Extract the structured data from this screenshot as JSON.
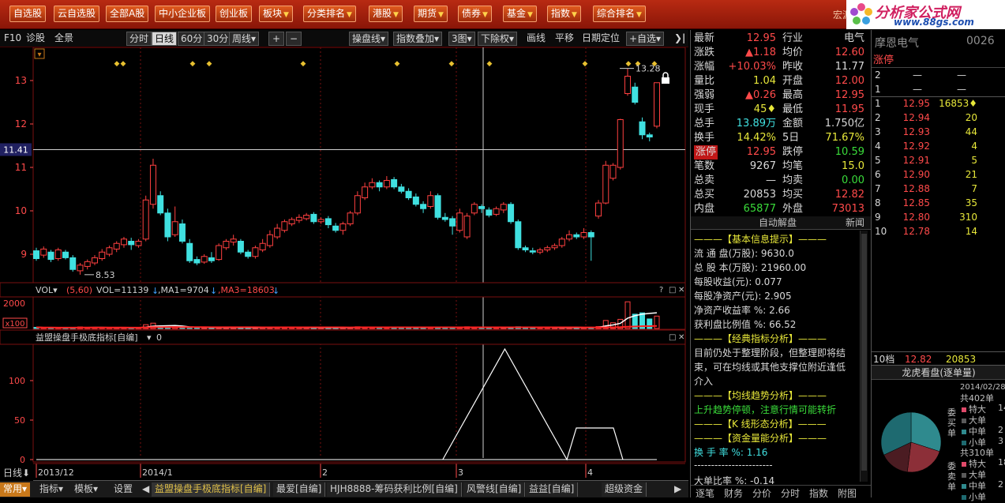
{
  "top_nav": {
    "items": [
      {
        "label": "自选股",
        "dropdown": false
      },
      {
        "label": "云自选股",
        "dropdown": false
      },
      {
        "label": "全部A股",
        "dropdown": false
      },
      {
        "label": "中小企业板",
        "dropdown": false
      },
      {
        "label": "创业板",
        "dropdown": false
      },
      {
        "label": "板块",
        "dropdown": true
      },
      {
        "label": "分类排名",
        "dropdown": true
      },
      {
        "label": "港股",
        "dropdown": true
      },
      {
        "label": "期货",
        "dropdown": true
      },
      {
        "label": "债券",
        "dropdown": true
      },
      {
        "label": "基金",
        "dropdown": true
      },
      {
        "label": "指数",
        "dropdown": true
      },
      {
        "label": "综合排名",
        "dropdown": true
      }
    ],
    "logo_title": "分析家公式网",
    "logo_url": "www.88gs.com",
    "logo_behind": "宏源大",
    "accent": "#b82a12"
  },
  "toolbar": {
    "f10": "F10",
    "diagnose": "诊股",
    "panorama": "全景",
    "periods": [
      "分时",
      "日线",
      "60分",
      "30分"
    ],
    "week": "周线▾",
    "zoom_in": "+",
    "zoom_out": "−",
    "manipulate": "操盘线▾",
    "index_overlay": "指数叠加▾",
    "three_chart": "3图▾",
    "exright": "下除权▾",
    "draw": "画线",
    "pan": "平移",
    "date_locate": "日期定位",
    "add_watch": "+自选▾"
  },
  "chart_data": {
    "type": "candlestick",
    "price_axis": {
      "ticks": [
        9,
        10,
        11,
        12,
        13
      ],
      "range": [
        8.3,
        13.5
      ]
    },
    "crosshair_price": "11.41",
    "high_label": "13.28",
    "low_label": "8.53",
    "x_labels": [
      "2013/12",
      "2014/1",
      "2",
      "3",
      "4"
    ],
    "candles": [
      [
        9.08,
        8.9,
        9.15,
        8.85
      ],
      [
        8.98,
        9.12,
        9.18,
        8.92
      ],
      [
        9.05,
        8.88,
        9.1,
        8.82
      ],
      [
        8.9,
        9.1,
        9.15,
        8.85
      ],
      [
        9.05,
        8.92,
        9.1,
        8.88
      ],
      [
        8.92,
        8.65,
        8.98,
        8.6
      ],
      [
        8.62,
        8.75,
        8.8,
        8.53
      ],
      [
        8.72,
        8.83,
        8.88,
        8.65
      ],
      [
        8.8,
        8.92,
        8.98,
        8.75
      ],
      [
        8.9,
        9.05,
        9.12,
        8.85
      ],
      [
        9.0,
        9.15,
        9.2,
        8.95
      ],
      [
        9.12,
        9.25,
        9.3,
        9.05
      ],
      [
        9.22,
        9.35,
        9.4,
        9.15
      ],
      [
        9.3,
        9.22,
        9.38,
        9.1
      ],
      [
        9.2,
        9.3,
        9.35,
        9.15
      ],
      [
        9.35,
        10.25,
        10.35,
        9.3
      ],
      [
        10.15,
        11.05,
        11.2,
        10.05
      ],
      [
        10.35,
        9.95,
        10.45,
        9.9
      ],
      [
        9.95,
        9.4,
        10.05,
        9.3
      ],
      [
        9.45,
        9.75,
        10.1,
        9.4
      ],
      [
        9.7,
        9.3,
        9.8,
        9.25
      ],
      [
        9.25,
        8.85,
        9.35,
        8.8
      ],
      [
        8.88,
        8.8,
        8.95,
        8.75
      ],
      [
        8.82,
        8.95,
        9.0,
        8.78
      ],
      [
        8.92,
        8.85,
        9.05,
        8.8
      ],
      [
        8.88,
        9.2,
        9.25,
        8.85
      ],
      [
        9.15,
        9.3,
        9.35,
        9.1
      ],
      [
        9.28,
        9.35,
        9.45,
        9.2
      ],
      [
        9.3,
        9.05,
        9.35,
        9.0
      ],
      [
        9.05,
        8.95,
        9.1,
        8.9
      ],
      [
        8.95,
        9.15,
        9.2,
        8.9
      ],
      [
        9.1,
        9.25,
        9.35,
        9.05
      ],
      [
        9.2,
        9.45,
        9.55,
        9.15
      ],
      [
        9.4,
        9.6,
        9.7,
        9.35
      ],
      [
        9.55,
        9.75,
        9.8,
        9.5
      ],
      [
        9.7,
        9.8,
        9.85,
        9.65
      ],
      [
        9.78,
        9.85,
        9.92,
        9.72
      ],
      [
        9.82,
        9.9,
        9.95,
        9.78
      ],
      [
        9.92,
        9.75,
        9.97,
        9.7
      ],
      [
        9.75,
        9.8,
        9.85,
        9.7
      ],
      [
        9.82,
        9.68,
        9.88,
        9.6
      ],
      [
        9.65,
        9.55,
        9.72,
        9.5
      ],
      [
        9.55,
        9.7,
        9.75,
        9.45
      ],
      [
        9.7,
        9.95,
        10.0,
        9.65
      ],
      [
        9.95,
        10.35,
        10.45,
        9.9
      ],
      [
        10.3,
        10.55,
        10.65,
        10.25
      ],
      [
        10.55,
        10.65,
        10.75,
        10.5
      ],
      [
        10.65,
        10.55,
        10.7,
        10.45
      ],
      [
        10.55,
        10.7,
        10.8,
        10.5
      ],
      [
        10.72,
        10.55,
        10.78,
        10.5
      ],
      [
        10.55,
        10.45,
        10.62,
        10.4
      ],
      [
        10.45,
        10.3,
        10.52,
        10.25
      ],
      [
        10.32,
        10.15,
        10.4,
        10.1
      ],
      [
        10.15,
        10.05,
        10.22,
        9.95
      ],
      [
        10.1,
        10.35,
        10.45,
        10.05
      ],
      [
        10.35,
        9.85,
        10.4,
        9.8
      ],
      [
        9.85,
        9.8,
        9.95,
        9.75
      ],
      [
        9.82,
        9.65,
        9.88,
        9.45
      ],
      [
        9.55,
        9.95,
        10.05,
        9.5
      ],
      [
        9.4,
        9.88,
        9.95,
        9.35
      ],
      [
        9.95,
        10.15,
        10.2,
        9.9
      ],
      [
        10.1,
        10.05,
        10.15,
        9.95
      ],
      [
        10.02,
        9.9,
        10.08,
        9.85
      ],
      [
        9.92,
        10.05,
        10.1,
        9.88
      ],
      [
        10.02,
        10.15,
        10.2,
        9.95
      ],
      [
        10.15,
        9.75,
        10.2,
        9.7
      ],
      [
        9.75,
        9.15,
        9.8,
        9.1
      ],
      [
        9.15,
        9.1,
        9.2,
        9.05
      ],
      [
        9.08,
        9.05,
        9.15,
        9.0
      ],
      [
        9.05,
        9.1,
        9.15,
        9.0
      ],
      [
        9.1,
        9.15,
        9.2,
        9.05
      ],
      [
        9.15,
        9.2,
        9.25,
        9.1
      ],
      [
        9.2,
        9.35,
        9.4,
        9.15
      ],
      [
        9.35,
        9.45,
        9.55,
        9.3
      ],
      [
        9.45,
        9.4,
        9.5,
        9.35
      ],
      [
        9.4,
        9.5,
        9.6,
        9.35
      ],
      [
        9.5,
        9.4,
        9.55,
        8.85
      ],
      [
        9.88,
        10.18,
        10.25,
        9.82
      ],
      [
        10.18,
        11.05,
        11.15,
        10.15
      ],
      [
        10.75,
        11.05,
        11.1,
        10.7
      ],
      [
        11.0,
        12.1,
        12.12,
        10.95
      ],
      [
        12.7,
        13.1,
        13.28,
        12.65
      ],
      [
        12.85,
        12.5,
        12.95,
        12.45
      ],
      [
        12.05,
        11.75,
        12.15,
        11.65
      ],
      [
        11.75,
        11.7,
        11.8,
        11.6
      ],
      [
        11.95,
        12.95,
        12.95,
        11.9
      ]
    ],
    "vol_axis": {
      "ticks": [
        "2000"
      ],
      "unit": "x100"
    },
    "vol_header": {
      "name": "VOL▾",
      "params": "(5,60)",
      "vol": "VOL=11139",
      "ma1": ",MA1=9704",
      "ma3": ",MA3=18603"
    },
    "vol_values": [
      60,
      40,
      50,
      40,
      35,
      60,
      80,
      55,
      45,
      40,
      50,
      45,
      45,
      40,
      40,
      200,
      280,
      120,
      80,
      90,
      70,
      45,
      40,
      45,
      40,
      55,
      50,
      45,
      40,
      35,
      50,
      55,
      60,
      55,
      50,
      45,
      40,
      40,
      45,
      40,
      40,
      45,
      40,
      55,
      90,
      80,
      70,
      60,
      60,
      55,
      50,
      50,
      45,
      45,
      60,
      70,
      45,
      60,
      70,
      90,
      55,
      45,
      40,
      45,
      45,
      60,
      90,
      60,
      45,
      40,
      40,
      45,
      45,
      50,
      40,
      45,
      60,
      100,
      420,
      300,
      480,
      1400,
      750,
      820,
      500,
      650
    ],
    "ind_header": {
      "name": "益盟操盘手极底指标[自编]",
      "value": "0"
    },
    "ind_axis": {
      "ticks": [
        0,
        50,
        100
      ]
    },
    "ind_values": [
      0,
      0,
      0,
      0,
      0,
      0,
      0,
      0,
      0,
      0,
      0,
      0,
      0,
      0,
      0,
      0,
      0,
      0,
      0,
      0,
      0,
      0,
      0,
      0,
      0,
      0,
      0,
      0,
      0,
      0,
      0,
      0,
      0,
      0,
      0,
      0,
      0,
      0,
      0,
      0,
      0,
      0,
      0,
      0,
      0,
      0,
      0,
      0,
      0,
      0,
      0,
      0,
      0,
      0,
      0,
      0,
      0,
      0,
      0,
      0,
      0,
      0,
      0,
      0,
      0,
      0,
      0,
      0,
      0,
      0,
      0,
      0,
      0,
      0,
      0,
      0,
      0,
      0,
      0,
      0,
      0,
      0,
      0,
      0,
      0,
      0
    ],
    "ind_spikes": [
      {
        "start": 0.655,
        "peak": 0.755,
        "end": 0.855,
        "height": 140
      },
      {
        "start": 0.855,
        "plateau_end": 0.93,
        "height": 40
      }
    ]
  },
  "bottom_tabs": {
    "period": "日线",
    "left": [
      "常用",
      "指标",
      "模板",
      "设置"
    ],
    "tabs": [
      "益盟操盘手极底指标[自编]",
      "最爱[自编]",
      "HJH8888-筹码获利比例[自编]",
      "风警线[自编]",
      "益益[自编]",
      "超级资金"
    ]
  },
  "quote": {
    "rows": [
      {
        "l1": "最新",
        "v1": "12.95",
        "c1": "red",
        "l2": "行业",
        "v2": "电气",
        "c2": "wht"
      },
      {
        "l1": "涨跌",
        "v1": "▲1.18",
        "c1": "red",
        "l2": "均价",
        "v2": "12.60",
        "c2": "red"
      },
      {
        "l1": "涨幅",
        "v1": "+10.03%",
        "c1": "red",
        "l2": "昨收",
        "v2": "11.77",
        "c2": "wht"
      },
      {
        "l1": "量比",
        "v1": "1.04",
        "c1": "yel",
        "l2": "开盘",
        "v2": "12.00",
        "c2": "red"
      },
      {
        "l1": "强弱",
        "v1": "▲0.26",
        "c1": "red",
        "l2": "最高",
        "v2": "12.95",
        "c2": "red"
      },
      {
        "l1": "现手",
        "v1": "45♦",
        "c1": "yel",
        "l2": "最低",
        "v2": "11.95",
        "c2": "red"
      },
      {
        "l1": "总手",
        "v1": "13.89万",
        "c1": "cyn",
        "l2": "金额",
        "v2": "1.750亿",
        "c2": "wht"
      },
      {
        "l1": "换手",
        "v1": "14.42%",
        "c1": "yel",
        "l2": "5日",
        "v2": "71.67%",
        "c2": "yel"
      },
      {
        "l1": "涨停",
        "v1": "12.95",
        "c1": "red",
        "l2": "跌停",
        "v2": "10.59",
        "c2": "grn"
      },
      {
        "l1": "笔数",
        "v1": "9267",
        "c1": "wht",
        "l2": "均笔",
        "v2": "15.0",
        "c2": "yel"
      },
      {
        "l1": "总卖",
        "v1": "—",
        "c1": "wht",
        "l2": "均卖",
        "v2": "0.00",
        "c2": "grn"
      },
      {
        "l1": "总买",
        "v1": "20853",
        "c1": "wht",
        "l2": "均买",
        "v2": "12.82",
        "c2": "red"
      },
      {
        "l1": "内盘",
        "v1": "65877",
        "c1": "grn",
        "l2": "外盘",
        "v2": "73013",
        "c2": "red"
      }
    ]
  },
  "f10": {
    "title": "自动解盘",
    "news": "新闻",
    "lines": [
      {
        "t": "———【基本信息提示】———",
        "c": "yel"
      },
      {
        "t": "流 通 盘(万股): 9630.0",
        "c": "wht"
      },
      {
        "t": "总 股 本(万股): 21960.00",
        "c": "wht"
      },
      {
        "t": "每股收益(元): 0.077",
        "c": "wht"
      },
      {
        "t": "每股净资产(元): 2.905",
        "c": "wht"
      },
      {
        "t": "净资产收益率 %: 2.66",
        "c": "wht"
      },
      {
        "t": "获利盘比例值 %: 66.52",
        "c": "wht"
      },
      {
        "t": "———【经典指标分析】———",
        "c": "yel"
      },
      {
        "t": "目前仍处于整理阶段，但整理即将结",
        "c": "wht"
      },
      {
        "t": "束，可在均线或其他支撑位附近逢低",
        "c": "wht"
      },
      {
        "t": "介入",
        "c": "wht"
      },
      {
        "t": "———【均线趋势分析】———",
        "c": "yel"
      },
      {
        "t": "上升趋势停顿，注意行情可能转折",
        "c": "grn"
      },
      {
        "t": "———【K 线形态分析】———",
        "c": "yel"
      },
      {
        "t": "———【资金量能分析】———",
        "c": "yel"
      },
      {
        "t": "换 手 率 %: 1.16",
        "c": "cyn"
      },
      {
        "t": "-----------------------",
        "c": "wht"
      },
      {
        "t": "大单比率 %: -0.14",
        "c": "wht"
      }
    ],
    "bottom_tabs": [
      "逐笔",
      "财务",
      "分价",
      "分时",
      "指数",
      "附图"
    ]
  },
  "book": {
    "stock_name": "摩恩电气",
    "stock_code": "0026",
    "limit_label": "涨停",
    "sells": [
      {
        "n": "2",
        "p": "—",
        "v": "—"
      },
      {
        "n": "1",
        "p": "—",
        "v": "—"
      }
    ],
    "buys": [
      {
        "n": "1",
        "p": "12.95",
        "v": "16853♦"
      },
      {
        "n": "2",
        "p": "12.94",
        "v": "20"
      },
      {
        "n": "3",
        "p": "12.93",
        "v": "44"
      },
      {
        "n": "4",
        "p": "12.92",
        "v": "4"
      },
      {
        "n": "5",
        "p": "12.91",
        "v": "5"
      },
      {
        "n": "6",
        "p": "12.90",
        "v": "21"
      },
      {
        "n": "7",
        "p": "12.88",
        "v": "7"
      },
      {
        "n": "8",
        "p": "12.85",
        "v": "35"
      },
      {
        "n": "9",
        "p": "12.80",
        "v": "310"
      },
      {
        "n": "10",
        "p": "12.78",
        "v": "14"
      }
    ],
    "ten": {
      "label": "10档",
      "p": "12.82",
      "v": "20853"
    },
    "dragon_title": "龙虎看盘(逐单量)",
    "dragon_date": "2014/02/28委",
    "buy_total": "共402单",
    "sell_total": "共310单",
    "buy_label": "委买单",
    "sell_label": "委卖单",
    "cats": [
      "特大",
      "大单",
      "中单",
      "小单"
    ],
    "buy_nums": [
      "14",
      "",
      "2",
      "3"
    ],
    "sell_nums": [
      "18",
      "",
      "2",
      ""
    ],
    "pie_colors": [
      "#2f8a8e",
      "#8c2f38",
      "#4b1c22",
      "#1e6a70"
    ]
  }
}
